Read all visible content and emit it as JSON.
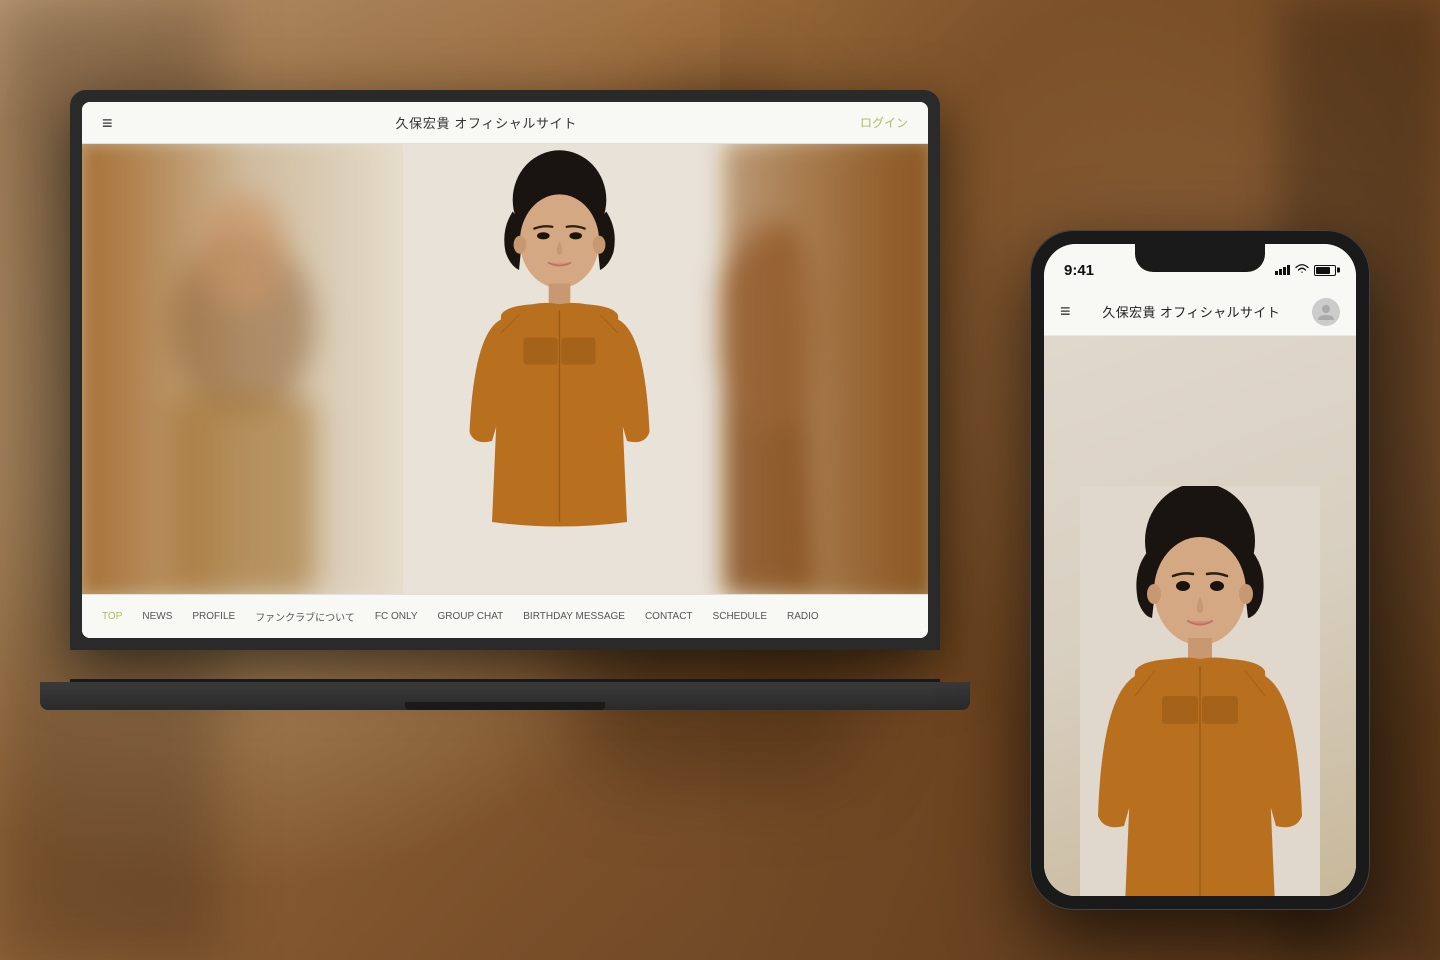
{
  "background": {
    "baseColor": "#8B5E3C"
  },
  "laptop": {
    "site_title": "久保宏貴 オフィシャルサイト",
    "login_label": "ログイン",
    "menu_icon": "≡",
    "nav_items": [
      {
        "label": "TOP",
        "active": true
      },
      {
        "label": "NEWS"
      },
      {
        "label": "PROFILE"
      },
      {
        "label": "ファンクラブについて"
      },
      {
        "label": "FC ONLY"
      },
      {
        "label": "GROUP CHAT"
      },
      {
        "label": "BIRTHDAY MESSAGE"
      },
      {
        "label": "CONTACT"
      },
      {
        "label": "SCHEDULE"
      },
      {
        "label": "RADIO"
      }
    ]
  },
  "phone": {
    "status_time": "9:41",
    "site_title": "久保宏貴 オフィシャルサイト",
    "menu_icon": "≡",
    "avatar_icon": "person"
  }
}
